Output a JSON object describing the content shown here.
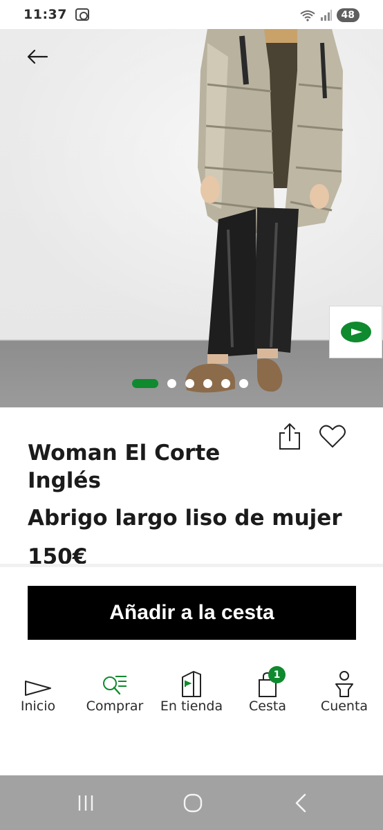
{
  "status_bar": {
    "time": "11:37",
    "battery": "48"
  },
  "hero": {
    "slide_count": 6,
    "active_slide": 0
  },
  "product": {
    "brand": "Woman El Corte Inglés",
    "title": "Abrigo largo liso de mujer",
    "price": "150€"
  },
  "cta": {
    "add_to_cart_label": "Añadir a la cesta"
  },
  "bottom_nav": {
    "items": [
      {
        "label": "Inicio",
        "icon": "home-flag-icon"
      },
      {
        "label": "Comprar",
        "icon": "search-list-icon"
      },
      {
        "label": "En tienda",
        "icon": "store-building-icon"
      },
      {
        "label": "Cesta",
        "icon": "shopping-bag-icon",
        "badge": "1"
      },
      {
        "label": "Cuenta",
        "icon": "person-icon"
      }
    ]
  },
  "colors": {
    "brand_green": "#0f8a2e",
    "cta_black": "#000000",
    "system_nav": "#a2a2a2"
  }
}
